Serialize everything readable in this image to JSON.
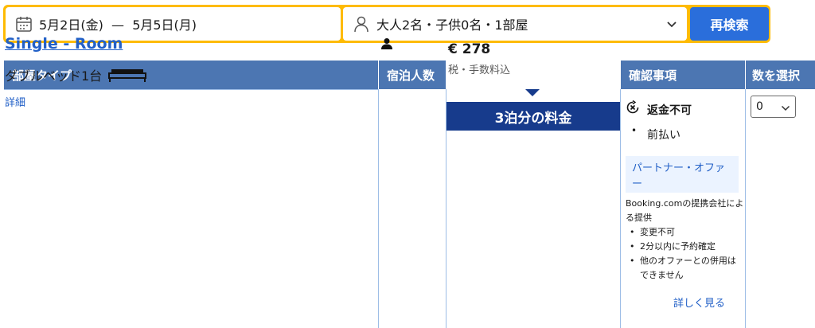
{
  "search": {
    "dates": "5月2日(金)  —  5月5日(月)",
    "guests": "大人2名・子供0名・1部屋",
    "button": "再検索"
  },
  "table": {
    "headers": {
      "room_type": "部屋タイプ",
      "occupancy": "宿泊人数",
      "price": "3泊分の料金",
      "conditions": "確認事項",
      "select": "数を選択"
    }
  },
  "room": {
    "name": "Single - Room",
    "bed": "ダブルベッド1台",
    "detail_link": "詳細",
    "price": "€ 278",
    "price_note": "税・手数料込",
    "cancellation": "返金不可",
    "payment": "前払い",
    "partner_offer": "パートナー・オファー",
    "partner_description": "Booking.comの提携会社による提供",
    "partner_points": [
      "変更不可",
      "2分以内に予約確定",
      "他のオファーとの併用はできません"
    ],
    "more_link": "詳しく見る",
    "quantity": "0"
  },
  "colors": {
    "search_border": "#febb02",
    "header_bg": "#4c76b2",
    "price_header_bg": "#173b8c",
    "link": "#2260c7",
    "button": "#2a6edb"
  }
}
